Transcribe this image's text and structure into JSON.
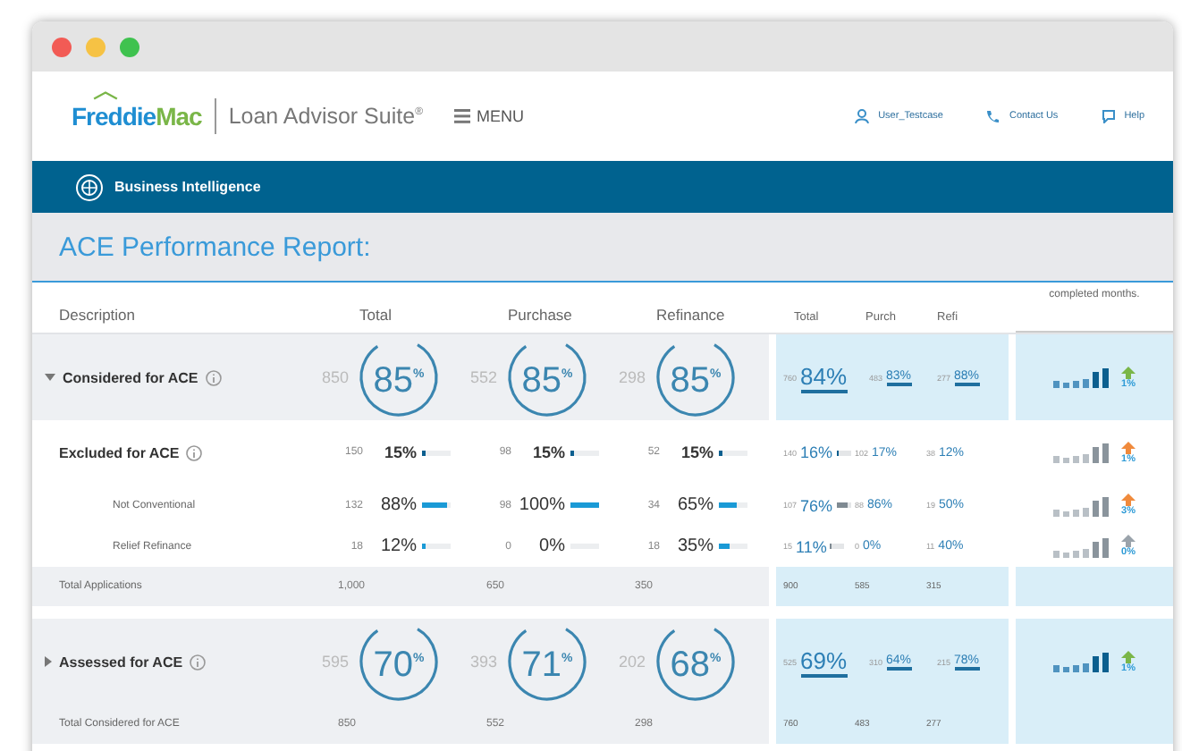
{
  "header": {
    "logo": {
      "first": "Freddie",
      "second": "Mac"
    },
    "product": "Loan Advisor Suite$^{®}$",
    "menu": "MENU",
    "links": [
      {
        "kind": "user",
        "label": "User_Testcase"
      },
      {
        "kind": "phone",
        "label": "Contact Us"
      },
      {
        "kind": "help",
        "label": "Help"
      }
    ]
  },
  "section_bar": {
    "title": "Business Intelligence"
  },
  "report_title": "ACE Performance Report:",
  "columns": [
    "Description",
    "Total",
    "Purchase",
    "Refinance"
  ],
  "summary_columns": [
    "Total",
    "Purch",
    "Refi"
  ],
  "trend_header": "completed months.",
  "rows": [
    {
      "kind": "group",
      "label": "Considered for ACE",
      "info": true,
      "expanded": true,
      "cells": [
        {
          "count": "850",
          "pct": "85$^{%}$"
        },
        {
          "count": "552",
          "pct": "85$^{%}$"
        },
        {
          "count": "298",
          "pct": "85$^{%}$"
        }
      ],
      "summary": [
        {
          "count": "760",
          "pct": "84%"
        },
        {
          "count": "483",
          "pct": "83%"
        },
        {
          "count": "277",
          "pct": "88%"
        }
      ],
      "trend": {
        "color": "#7ab648",
        "change": "1%"
      }
    },
    {
      "kind": "sub",
      "label": "Excluded for ACE",
      "info": true,
      "cells": [
        {
          "count": "150",
          "pct": "15%",
          "level": 0.15
        },
        {
          "count": "98",
          "pct": "15%",
          "level": 0.15
        },
        {
          "count": "52",
          "pct": "15%",
          "level": 0.15
        }
      ],
      "summary": [
        {
          "count": "140",
          "pct": "16%",
          "level": 0.16
        },
        {
          "count": "102",
          "pct": "17%"
        },
        {
          "count": "38",
          "pct": "12%"
        }
      ],
      "trend": {
        "color": "#f08a3c",
        "change": "1%"
      }
    },
    {
      "kind": "detail",
      "label": "Not Conventional",
      "cells": [
        {
          "count": "132",
          "pct": "88%",
          "level": 0.88
        },
        {
          "count": "98",
          "pct": "100%",
          "level": 1
        },
        {
          "count": "34",
          "pct": "65%",
          "level": 0.65
        }
      ],
      "summary": [
        {
          "count": "107",
          "pct": "76%",
          "level": 0.76
        },
        {
          "count": "88",
          "pct": "86%"
        },
        {
          "count": "19",
          "pct": "50%"
        }
      ],
      "trend": {
        "color": "#f08a3c",
        "change": "3%"
      }
    },
    {
      "kind": "detail",
      "label": "Relief Refinance",
      "cells": [
        {
          "count": "18",
          "pct": "12%",
          "level": 0.12
        },
        {
          "count": "0",
          "pct": "0%"
        },
        {
          "count": "18",
          "pct": "35%",
          "level": 0.35
        }
      ],
      "summary": [
        {
          "count": "15",
          "pct": "11%",
          "level": 0.11
        },
        {
          "count": "0",
          "pct": "0%"
        },
        {
          "count": "11",
          "pct": "40%"
        }
      ],
      "trend": {
        "color": "#9aa3ab",
        "change": "0%"
      }
    },
    {
      "kind": "total",
      "label": "Total Applications",
      "cells": [
        {
          "count": "1,000"
        },
        {
          "count": "650"
        },
        {
          "count": "350"
        }
      ],
      "summary": [
        {
          "count": "900"
        },
        {
          "count": "585"
        },
        {
          "count": "315"
        }
      ]
    },
    {
      "kind": "group",
      "label": "Assessed for ACE",
      "info": true,
      "expanded": false,
      "cells": [
        {
          "count": "595",
          "pct": "70$^{%}$"
        },
        {
          "count": "393",
          "pct": "71$^{%}$"
        },
        {
          "count": "202",
          "pct": "68$^{%}$"
        }
      ],
      "summary": [
        {
          "count": "525",
          "pct": "69%"
        },
        {
          "count": "310",
          "pct": "64%"
        },
        {
          "count": "215",
          "pct": "78%"
        }
      ],
      "trend": {
        "color": "#7ab648",
        "change": "1%"
      }
    },
    {
      "kind": "total",
      "label": "Total Considered for ACE",
      "cells": [
        {
          "count": "850"
        },
        {
          "count": "552"
        },
        {
          "count": "298"
        }
      ],
      "summary": [
        {
          "count": "760"
        },
        {
          "count": "483"
        },
        {
          "count": "277"
        }
      ]
    }
  ]
}
